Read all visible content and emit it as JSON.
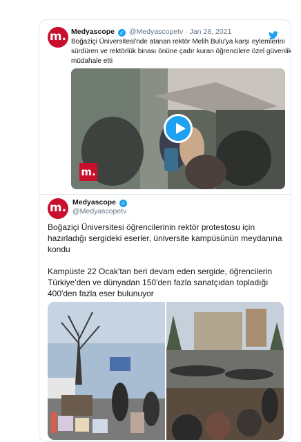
{
  "quoted": {
    "name": "Medyascope",
    "meta": "@Medyascopetv · Jan 28, 2021",
    "text": "Boğaziçi Üniversitesi'nde atanan rektör Melih Bulu'ya karşı eylemlerini sürdüren ve rektörlük binası önüne çadır kuran öğrencilere özel güvenlik müdahale etti",
    "avatar_letter": "m.",
    "video_badge": "m."
  },
  "tweet": {
    "name": "Medyascope",
    "handle": "@Medyascopetv",
    "avatar_letter": "m.",
    "paragraph1": "Boğaziçi Üniversitesi öğrencilerinin rektör protestosu için hazırladığı sergideki eserler, üniversite kampüsünün meydanına kondu",
    "paragraph2": "Kampüste 22 Ocak'tan beri devam eden sergide, öğrencilerin Türkiye'den ve dünyadan 150'den fazla sanatçıdan topladığı 400'den fazla eser bulunuyor"
  },
  "colors": {
    "brand": "#c8102e",
    "twitter_blue": "#1da1f2",
    "muted": "#657786"
  },
  "icons": [
    "twitter-bird-icon",
    "verified-icon",
    "play-icon"
  ]
}
